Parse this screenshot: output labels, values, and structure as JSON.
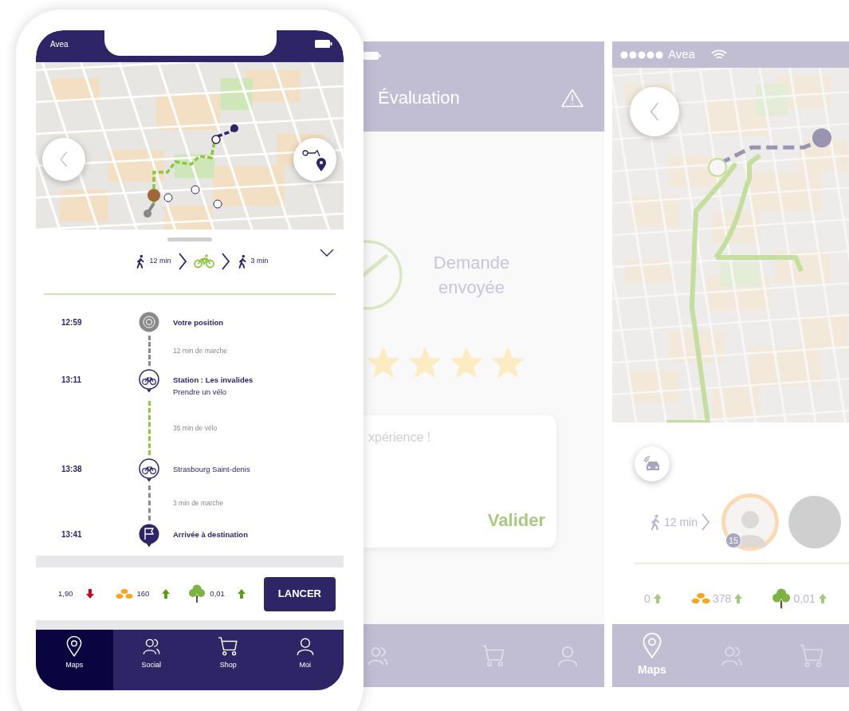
{
  "phone": {
    "status_bar": {
      "carrier": "Avea"
    },
    "summary": {
      "legs": [
        {
          "kind": "walk",
          "duration": "12 min",
          "selected": false
        },
        {
          "kind": "bike",
          "selected": true
        },
        {
          "kind": "walk",
          "duration": "3 min",
          "selected": false
        }
      ]
    },
    "itinerary": [
      {
        "kind": "position",
        "time": "12:59",
        "title": "Votre position",
        "emphasized": true
      },
      {
        "kind": "walk",
        "label": "12 min de marche"
      },
      {
        "kind": "bike_station",
        "time": "13:11",
        "title": "Station : Les invalides",
        "subtitle": "Prendre un vélo",
        "emphasized": true
      },
      {
        "kind": "ride",
        "label": "35 min de vélo"
      },
      {
        "kind": "bike_station",
        "time": "13:38",
        "title": "Strasbourg Saint-denis",
        "emphasized": false
      },
      {
        "kind": "walk",
        "label": "3 min de marche"
      },
      {
        "kind": "destination",
        "time": "13:41",
        "title": "Arrivée à destination",
        "emphasized": true
      }
    ],
    "stats": [
      {
        "kind": "price",
        "value": "1,90",
        "rising": false
      },
      {
        "kind": "coins",
        "value": "160",
        "rising": true
      },
      {
        "kind": "tree",
        "value": "0,01",
        "rising": true
      }
    ],
    "launch_button": "LANCER",
    "tabs": [
      {
        "kind": "map",
        "label": "Maps",
        "selected": true
      },
      {
        "kind": "social",
        "label": "Social",
        "selected": false
      },
      {
        "kind": "shop",
        "label": "Shop",
        "selected": false
      },
      {
        "kind": "profile",
        "label": "Moi",
        "selected": false
      }
    ]
  },
  "rating_screen": {
    "title": "Évaluation",
    "status": "Demande envoyée",
    "stars": 4,
    "comment": {
      "placeholder": "xpérience !"
    },
    "submit": "Valider",
    "tabs": [
      {
        "kind": "social",
        "selected": false
      },
      {
        "kind": "shop",
        "selected": false
      },
      {
        "kind": "profile",
        "selected": false
      }
    ]
  },
  "ride_screen": {
    "status_bar": {
      "carrier": "Avea"
    },
    "route": {
      "duration": "12 min"
    },
    "driver": {
      "level": "15"
    },
    "stats": [
      {
        "kind": "price",
        "value": "0",
        "rising": true
      },
      {
        "kind": "coins",
        "value": "378",
        "rising": true
      },
      {
        "kind": "tree",
        "value": "0,01",
        "rising": true
      }
    ],
    "tabs": [
      {
        "kind": "map",
        "label": "Maps",
        "selected": true
      },
      {
        "kind": "social",
        "selected": false
      },
      {
        "kind": "shop",
        "selected": false
      }
    ]
  }
}
